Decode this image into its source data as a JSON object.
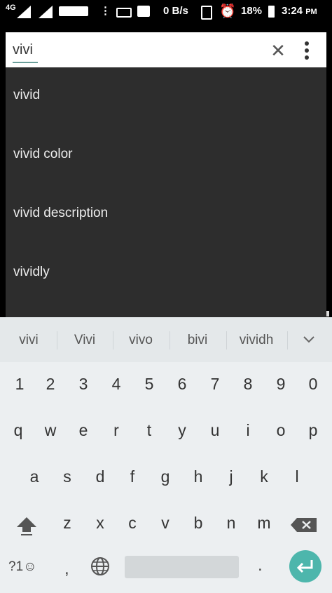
{
  "status_bar": {
    "network": "4G",
    "data_speed": "0 B/s",
    "battery": "18%",
    "time": "3:24",
    "time_suffix": "PM"
  },
  "search": {
    "query": "vivi"
  },
  "suggestions": [
    "vivid",
    "vivid color",
    "vivid description",
    "vividly"
  ],
  "keyboard": {
    "candidates": [
      "vivi",
      "Vivi",
      "vivo",
      "bivi",
      "vividh"
    ],
    "number_row": [
      "1",
      "2",
      "3",
      "4",
      "5",
      "6",
      "7",
      "8",
      "9",
      "0"
    ],
    "row1": [
      "q",
      "w",
      "e",
      "r",
      "t",
      "y",
      "u",
      "i",
      "o",
      "p"
    ],
    "row2": [
      "a",
      "s",
      "d",
      "f",
      "g",
      "h",
      "j",
      "k",
      "l"
    ],
    "row3": [
      "z",
      "x",
      "c",
      "v",
      "b",
      "n",
      "m"
    ],
    "symbols_label": "?1☺",
    "comma_label": ",",
    "period_label": "."
  },
  "colors": {
    "suggestion_bg": "#2d2d2d",
    "enter_key": "#4db6ac",
    "keyboard_bg": "#eceff1"
  }
}
